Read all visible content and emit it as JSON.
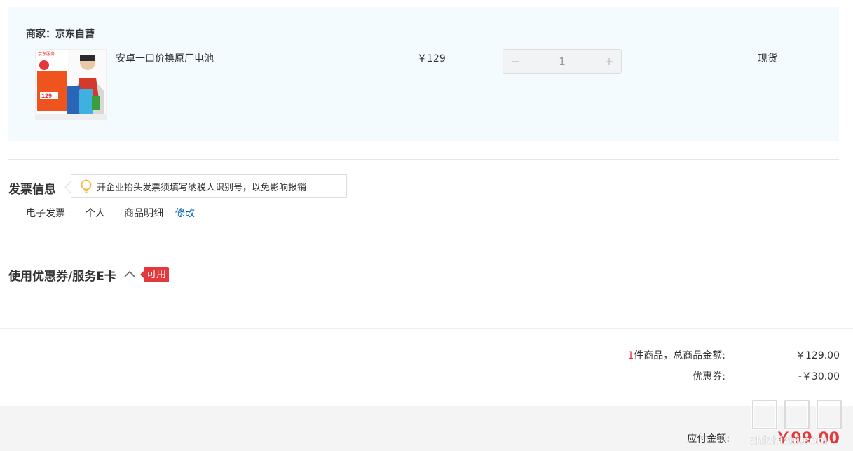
{
  "merchant": {
    "title": "商家：京东自营",
    "item": {
      "name": "安卓一口价换原厂电池",
      "price": "￥129",
      "quantity": "1",
      "stock": "现货",
      "image": {
        "brand_text": "京东服务",
        "price_text": "129"
      }
    }
  },
  "invoice": {
    "title": "发票信息",
    "tip": "开企业抬头发票须填写纳税人识别号，以免影响报销",
    "type": "电子发票",
    "holder": "个人",
    "content": "商品明细",
    "edit_label": "修改"
  },
  "coupon": {
    "title": "使用优惠券/服务E卡",
    "badge": "可用"
  },
  "summary": {
    "count": "1",
    "count_suffix": "件商品，总商品金额:",
    "total": "￥129.00",
    "coupon_label": "优惠券:",
    "coupon_value": "-￥30.00",
    "payable_label": "应付金额:",
    "payable_value": "￥99.00"
  },
  "watermark": {
    "text": "zhizhizhi.com"
  },
  "colors": {
    "accent": "#e4393c",
    "link": "#005ea7",
    "panel": "#f3fbfe"
  }
}
